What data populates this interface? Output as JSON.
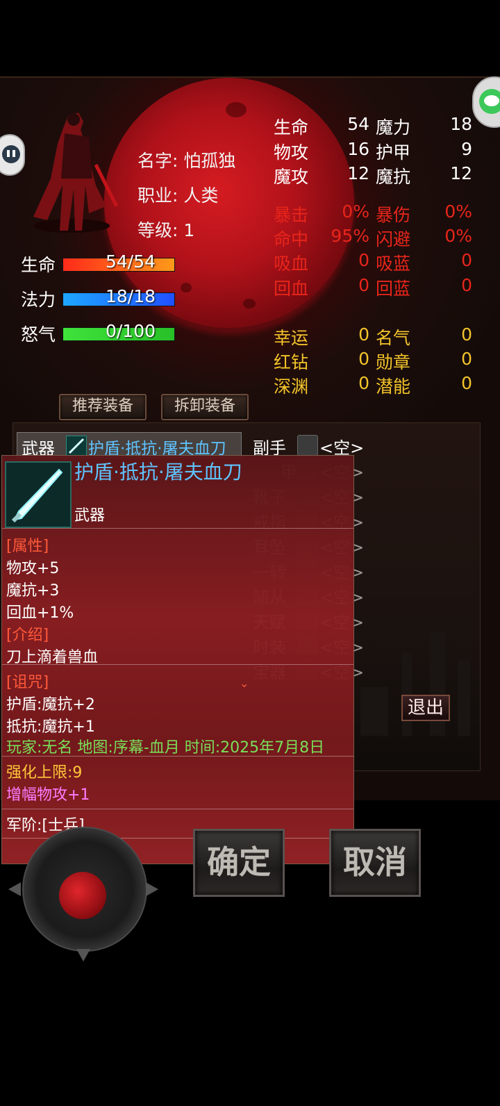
{
  "character": {
    "name_line": "名字: 怕孤独",
    "class_line": "职业: 人类",
    "level_line": "等级: 1"
  },
  "bars": [
    {
      "label": "生命",
      "value": "54/54",
      "color": "#ff2a1a",
      "fill": 1.0
    },
    {
      "label": "法力",
      "value": "18/18",
      "color": "#1ea7ff",
      "fill": 1.0
    },
    {
      "label": "怒气",
      "value": "0/100",
      "color": "#3ee23a",
      "fill": 1.0
    }
  ],
  "stats_primary": [
    {
      "l1": "生命",
      "v1": "54",
      "l2": "魔力",
      "v2": "18"
    },
    {
      "l1": "物攻",
      "v1": "16",
      "l2": "护甲",
      "v2": "9"
    },
    {
      "l1": "魔攻",
      "v1": "12",
      "l2": "魔抗",
      "v2": "12"
    }
  ],
  "stats_secondary": [
    {
      "l1": "暴击",
      "v1": "0%",
      "l2": "暴伤",
      "v2": "0%"
    },
    {
      "l1": "命中",
      "v1": "95%",
      "l2": "闪避",
      "v2": "0%"
    },
    {
      "l1": "吸血",
      "v1": "0",
      "l2": "吸蓝",
      "v2": "0"
    },
    {
      "l1": "回血",
      "v1": "0",
      "l2": "回蓝",
      "v2": "0"
    }
  ],
  "stats_misc": [
    {
      "l1": "幸运",
      "v1": "0",
      "l2": "名气",
      "v2": "0"
    },
    {
      "l1": "红钻",
      "v1": "0",
      "l2": "勋章",
      "v2": "0"
    },
    {
      "l1": "深渊",
      "v1": "0",
      "l2": "潜能",
      "v2": "0"
    }
  ],
  "buttons": {
    "recommend": "推荐装备",
    "unequip": "拆卸装备",
    "exit": "退出",
    "confirm": "确定",
    "cancel": "取消"
  },
  "equipment": {
    "weapon_label": "武器",
    "weapon_item": "护盾·抵抗·屠夫血刀",
    "offhand_label": "副手",
    "empty": "<空>",
    "right_slots": [
      "甲",
      "靴子",
      "戒指",
      "耳坠",
      "一转",
      "随从",
      "天赋",
      "时装",
      "宝器"
    ]
  },
  "popup": {
    "title": "护盾·抵抗·屠夫血刀",
    "type": "武器",
    "attr_header": "[属性]",
    "attrs": [
      "物攻+5",
      "魔抗+3",
      "回血+1%"
    ],
    "intro_header": "[介绍]",
    "intro": "刀上滴着兽血",
    "curse_header": "[诅咒]",
    "curses": [
      "护盾:魔抗+2",
      "抵抗:魔抗+1"
    ],
    "record": "玩家:无名 地图:序幕-血月 时间:2025年7月8日",
    "enhance": "强化上限:9",
    "amplify": "增幅物攻+1",
    "rank": "军阶:[士兵]"
  },
  "colors": {
    "stat_white": "#ffffff",
    "stat_red": "#e8251b",
    "stat_yellow": "#f3c42b",
    "item_blue": "#5fc3ff",
    "header_red": "#ff5a3a",
    "record_green": "#7adf5a",
    "enhance_gold": "#ffc83a",
    "amplify_purple": "#ff7cff"
  }
}
